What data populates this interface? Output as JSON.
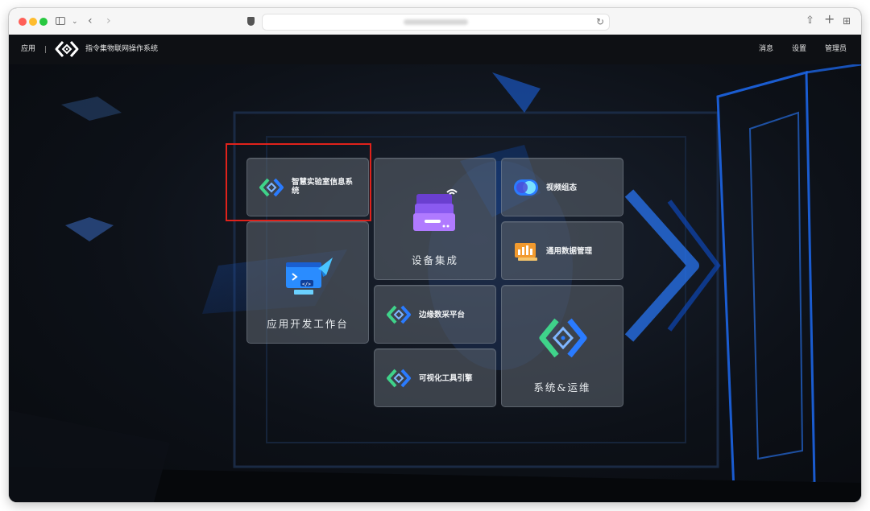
{
  "browser": {
    "url_blurred": true
  },
  "header": {
    "app_label": "应用",
    "system_title": "指令集物联网操作系统",
    "nav": [
      "消息",
      "设置",
      "管理员"
    ]
  },
  "tiles": {
    "smart_lab": "智慧实验室信息系统",
    "device_integration": "设备集成",
    "video_config": "视频组态",
    "app_workbench": "应用开发工作台",
    "general_data": "通用数据管理",
    "edge_collection": "边缘数采平台",
    "ops": "系统&运维",
    "visual_engine": "可视化工具引擎"
  },
  "colors": {
    "accent_blue": "#1e6fff",
    "logo_green": "#3fd38a",
    "logo_blue": "#2a7bff",
    "highlight_red": "#e0221b"
  },
  "icons": {
    "smart_lab": "logo-chevrons-icon",
    "device_integration": "stacked-devices-icon",
    "video_config": "video-toggle-icon",
    "app_workbench": "code-monitor-icon",
    "general_data": "data-chart-icon",
    "edge_collection": "logo-chevrons-icon",
    "ops": "logo-chevrons-icon",
    "visual_engine": "logo-chevrons-icon"
  }
}
